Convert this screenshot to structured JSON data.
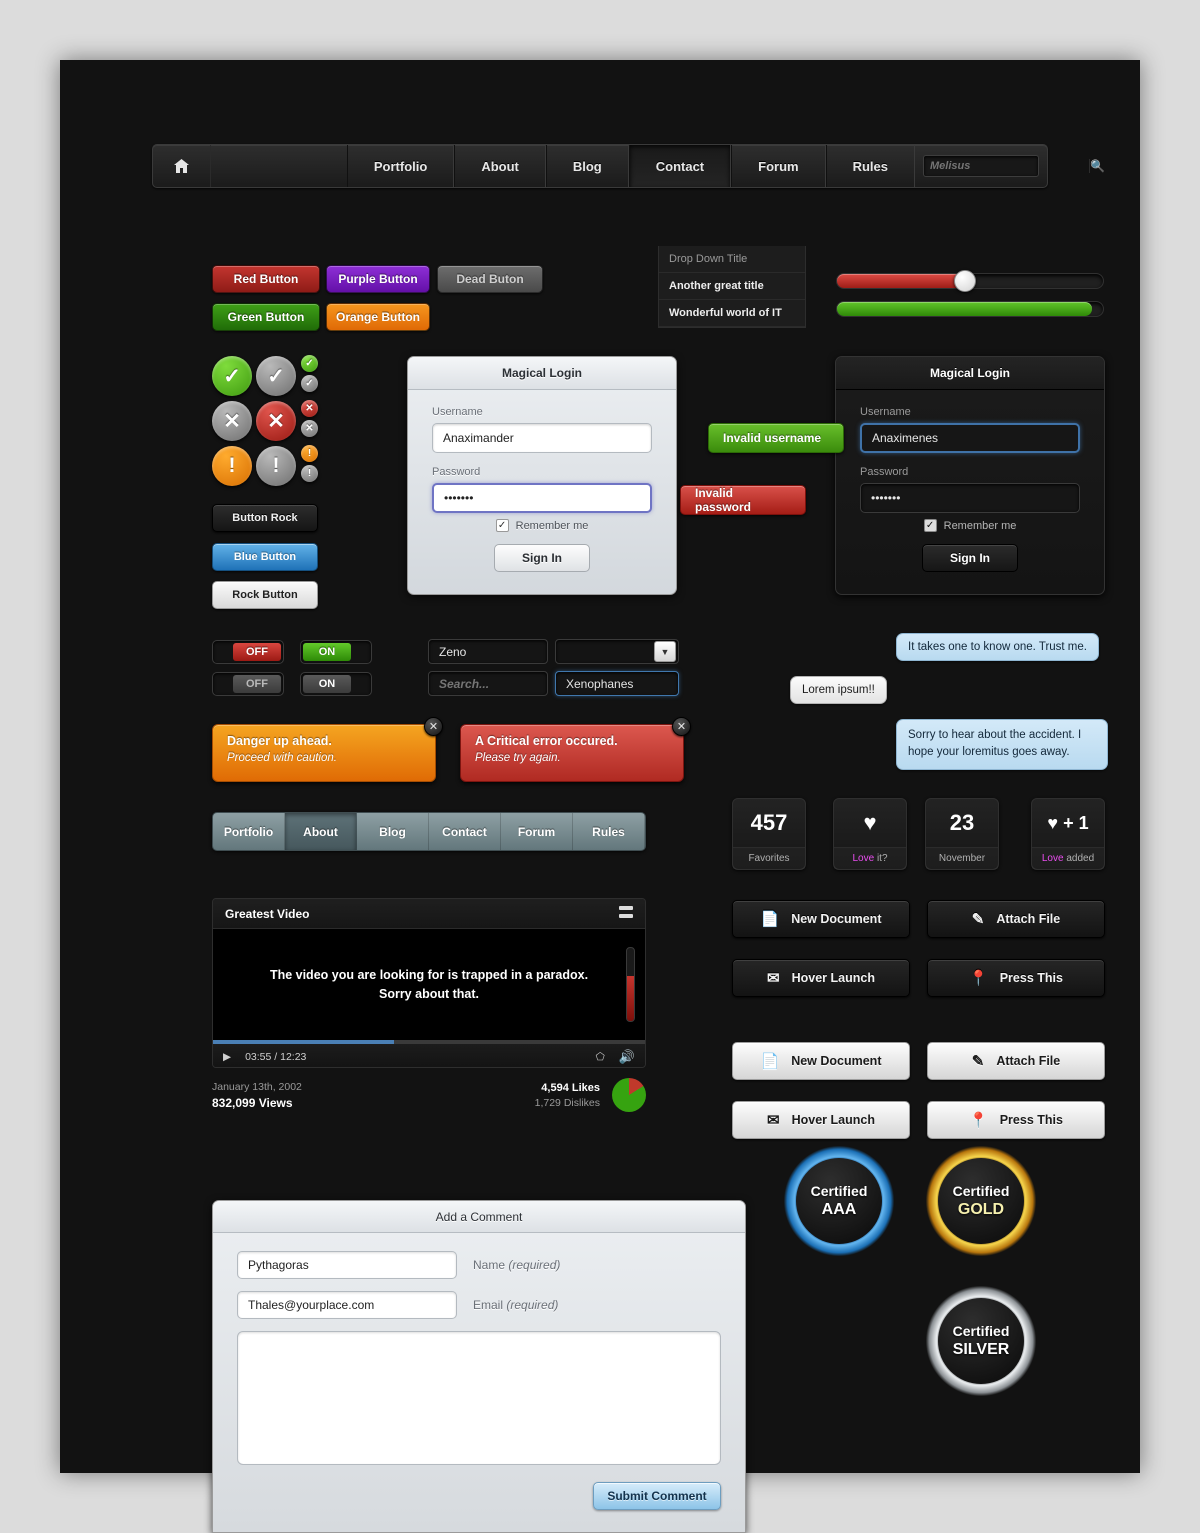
{
  "nav": {
    "home_icon": "home-icon",
    "items": [
      {
        "label": "Portfolio",
        "active": false
      },
      {
        "label": "About",
        "active": false
      },
      {
        "label": "Blog",
        "active": false
      },
      {
        "label": "Contact",
        "active": true
      },
      {
        "label": "Forum",
        "active": false
      },
      {
        "label": "Rules",
        "active": false
      }
    ],
    "search": {
      "placeholder": "Melisus",
      "value": "",
      "icon": "search-icon"
    }
  },
  "color_buttons": [
    {
      "label": "Red Button",
      "color": "#c3352f"
    },
    {
      "label": "Purple Button",
      "color": "#8e2fd6"
    },
    {
      "label": "Dead Buton",
      "color": "#6d6d6d"
    },
    {
      "label": "Green Button",
      "color": "#3fa017"
    },
    {
      "label": "Orange Button",
      "color": "#f6961e"
    }
  ],
  "dropdown": {
    "items": [
      {
        "label": "Drop Down Title"
      },
      {
        "label": "Another great title"
      },
      {
        "label": "Wonderful world of IT"
      }
    ]
  },
  "sliders": [
    {
      "name": "red-slider",
      "value": 48,
      "color": "#de4b44"
    },
    {
      "name": "green-slider",
      "value": 96,
      "color": "#61c52a"
    }
  ],
  "status_icons": {
    "check": "✓",
    "cross": "✕",
    "bang": "!"
  },
  "plain_buttons": [
    {
      "label": "Button Rock",
      "style": "dark"
    },
    {
      "label": "Blue Button",
      "style": "blue"
    },
    {
      "label": "Rock Button",
      "style": "light"
    }
  ],
  "login_light": {
    "title": "Magical Login",
    "username_label": "Username",
    "username_value": "Anaximander",
    "password_label": "Password",
    "password_value": "•••••••",
    "remember_label": "Remember me",
    "remember_checked": "✓",
    "signin_label": "Sign In"
  },
  "login_dark": {
    "title": "Magical Login",
    "username_label": "Username",
    "username_value": "Anaximenes",
    "password_label": "Password",
    "password_value": "•••••••",
    "remember_label": "Remember me",
    "remember_checked": "✓",
    "signin_label": "Sign In"
  },
  "validation": {
    "invalid_username": "Invalid username",
    "invalid_password": "Invalid password"
  },
  "toggles": [
    {
      "name": "toggle-off-red",
      "label": "OFF",
      "state": "off"
    },
    {
      "name": "toggle-on-green",
      "label": "ON",
      "state": "on"
    },
    {
      "name": "toggle-off-grey",
      "label": "OFF",
      "state": "off"
    },
    {
      "name": "toggle-on-grey",
      "label": "ON",
      "state": "on"
    }
  ],
  "fields": {
    "stepper_value": "Zeno",
    "stepper_icon": "up-down-arrows-icon",
    "search_placeholder": "Search...",
    "search_icon": "search-icon",
    "select_arrow": "▼",
    "focused_value": "Xenophanes"
  },
  "alerts": [
    {
      "title": "Danger up ahead.",
      "subtitle": "Proceed with caution.",
      "color": "#f5a521",
      "close": "✕"
    },
    {
      "title": "A Critical error occured.",
      "subtitle": "Please try again.",
      "color": "#dc584f",
      "close": "✕"
    }
  ],
  "tabbar": {
    "tabs": [
      {
        "label": "Portfolio",
        "active": false
      },
      {
        "label": "About",
        "active": true
      },
      {
        "label": "Blog",
        "active": false
      },
      {
        "label": "Contact",
        "active": false
      },
      {
        "label": "Forum",
        "active": false
      },
      {
        "label": "Rules",
        "active": false
      }
    ]
  },
  "chat": [
    {
      "text": "It takes one to know one. Trust me.",
      "side": "right"
    },
    {
      "text": "Lorem ipsum!!",
      "side": "left"
    },
    {
      "text": "Sorry to hear about the accident. I hope your loremitus goes away.",
      "side": "right"
    }
  ],
  "video": {
    "title": "Greatest Video",
    "expand_icon": "expand-icon",
    "message_line1": "The video you are looking for is trapped in a paradox.",
    "message_line2": "Sorry about that.",
    "play_icon": "▶",
    "time": "03:55 / 12:23",
    "hd_icon": "hd-icon",
    "volume_icon": "speaker-icon",
    "progress_percent": 42,
    "volume_percent": 62,
    "date": "January 13th, 2002",
    "views": "832,099 Views",
    "likes": "4,594 Likes",
    "dislikes": "1,729 Dislikes"
  },
  "counters": [
    {
      "value": "457",
      "label": "Favorites",
      "type": "number"
    },
    {
      "value": "♥",
      "label": "Love it?",
      "type": "heart",
      "label_highlight": "Love"
    },
    {
      "value": "23",
      "label": "November",
      "type": "number"
    },
    {
      "value": "♥ + 1",
      "label": "Love added",
      "type": "heart",
      "label_highlight": "Love"
    }
  ],
  "icon_buttons_dark": [
    {
      "label": "New Document",
      "icon": "document-icon",
      "glyph": "📄"
    },
    {
      "label": "Attach File",
      "icon": "paperclip-icon",
      "glyph": "✐"
    },
    {
      "label": "Hover Launch",
      "icon": "envelope-icon",
      "glyph": "✉"
    },
    {
      "label": "Press This",
      "icon": "map-pin-icon",
      "glyph": "•"
    }
  ],
  "icon_buttons_light": [
    {
      "label": "New Document",
      "icon": "document-icon",
      "glyph": "📄"
    },
    {
      "label": "Attach File",
      "icon": "paperclip-icon",
      "glyph": "✐"
    },
    {
      "label": "Hover Launch",
      "icon": "envelope-icon",
      "glyph": "✉"
    },
    {
      "label": "Press This",
      "icon": "map-pin-icon",
      "glyph": "•"
    }
  ],
  "comment_form": {
    "title": "Add a Comment",
    "name_value": "Pythagoras",
    "name_label": "Name",
    "name_required": "(required)",
    "email_value": "Thales@yourplace.com",
    "email_label": "Email",
    "email_required": "(required)",
    "body_value": "",
    "submit_label": "Submit Comment"
  },
  "badges": [
    {
      "line1": "Certified",
      "line2": "AAA",
      "color": "#63b5ef",
      "text_color": "#ffffff"
    },
    {
      "line1": "Certified",
      "line2": "GOLD",
      "color": "#f7d64d",
      "text_color": "#f6f0ae"
    },
    {
      "line1": "Certified",
      "line2": "SILVER",
      "color": "#eceff1",
      "text_color": "#ffffff"
    }
  ]
}
